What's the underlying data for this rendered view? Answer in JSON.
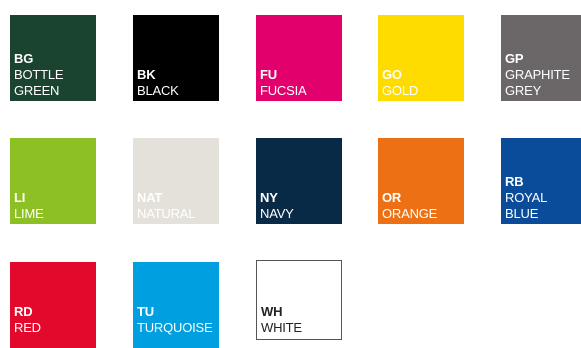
{
  "swatches": [
    {
      "code": "BG",
      "name": "BOTTLE\nGREEN",
      "color": "#1a4430",
      "text_color": "#ffffff"
    },
    {
      "code": "BK",
      "name": "BLACK",
      "color": "#000000",
      "text_color": "#ffffff"
    },
    {
      "code": "FU",
      "name": "FUCSIA",
      "color": "#e2006d",
      "text_color": "#ffffff"
    },
    {
      "code": "GO",
      "name": "GOLD",
      "color": "#ffdc00",
      "text_color": "#ffffff"
    },
    {
      "code": "GP",
      "name": "GRAPHITE\nGREY",
      "color": "#6b6668",
      "text_color": "#ffffff"
    },
    {
      "code": "LI",
      "name": "LIME",
      "color": "#8cc024",
      "text_color": "#ffffff"
    },
    {
      "code": "NAT",
      "name": "NATURAL",
      "color": "#e4e1da",
      "text_color": "#ffffff"
    },
    {
      "code": "NY",
      "name": "NAVY",
      "color": "#082a46",
      "text_color": "#ffffff"
    },
    {
      "code": "OR",
      "name": "ORANGE",
      "color": "#ee7014",
      "text_color": "#ffffff"
    },
    {
      "code": "RB",
      "name": "ROYAL\nBLUE",
      "color": "#0a4c9a",
      "text_color": "#ffffff"
    },
    {
      "code": "RD",
      "name": "RED",
      "color": "#e2092c",
      "text_color": "#ffffff"
    },
    {
      "code": "TU",
      "name": "TURQUOISE",
      "color": "#009fdf",
      "text_color": "#ffffff"
    },
    {
      "code": "WH",
      "name": "WHITE",
      "color": "#ffffff",
      "text_color": "#222222",
      "outlined": true
    }
  ]
}
